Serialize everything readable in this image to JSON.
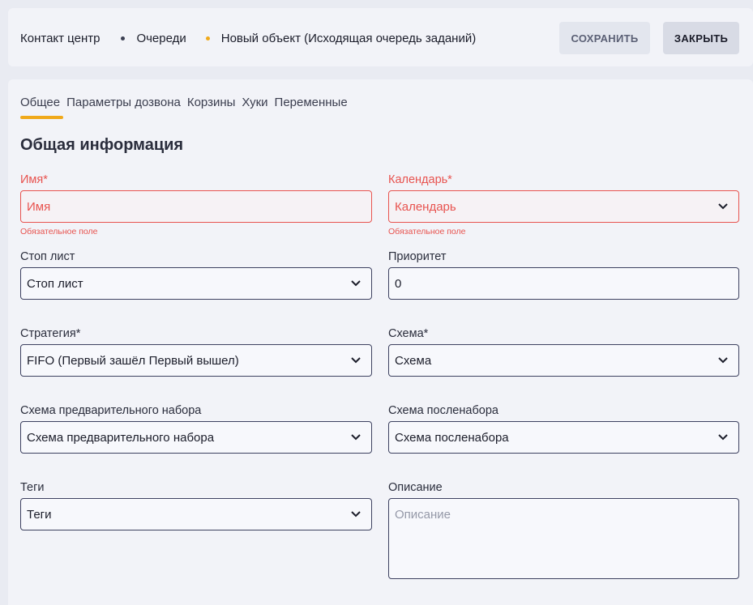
{
  "header": {
    "breadcrumb": {
      "root": "Контакт центр",
      "parent": "Очереди",
      "current": "Новый объект (Исходящая очередь заданий)"
    },
    "save_label": "СОХРАНИТЬ",
    "close_label": "ЗАКРЫТЬ"
  },
  "tabs": [
    {
      "label": "Общее",
      "active": true
    },
    {
      "label": "Параметры дозвона"
    },
    {
      "label": "Корзины"
    },
    {
      "label": "Хуки"
    },
    {
      "label": "Переменные"
    }
  ],
  "section_title": "Общая информация",
  "fields": {
    "name": {
      "label": "Имя*",
      "placeholder": "Имя",
      "error": "Обязательное поле"
    },
    "calendar": {
      "label": "Календарь*",
      "placeholder": "Календарь",
      "error": "Обязательное поле"
    },
    "stop_list": {
      "label": "Стоп лист",
      "value": "Стоп лист"
    },
    "priority": {
      "label": "Приоритет",
      "value": "0"
    },
    "strategy": {
      "label": "Стратегия*",
      "value": "FIFO (Первый зашёл Первый вышел)"
    },
    "scheme": {
      "label": "Схема*",
      "value": "Схема"
    },
    "pre_dial": {
      "label": "Схема предварительного набора",
      "value": "Схема предварительного набора"
    },
    "post_dial": {
      "label": "Схема посленабора",
      "value": "Схема посленабора"
    },
    "tags": {
      "label": "Теги",
      "value": "Теги"
    },
    "description": {
      "label": "Описание",
      "placeholder": "Описание"
    }
  },
  "icons": {
    "select": "chevron-down-icon"
  },
  "colors": {
    "accent": "#f0a91a",
    "error": "#e8534f",
    "border": "#3d4160"
  }
}
